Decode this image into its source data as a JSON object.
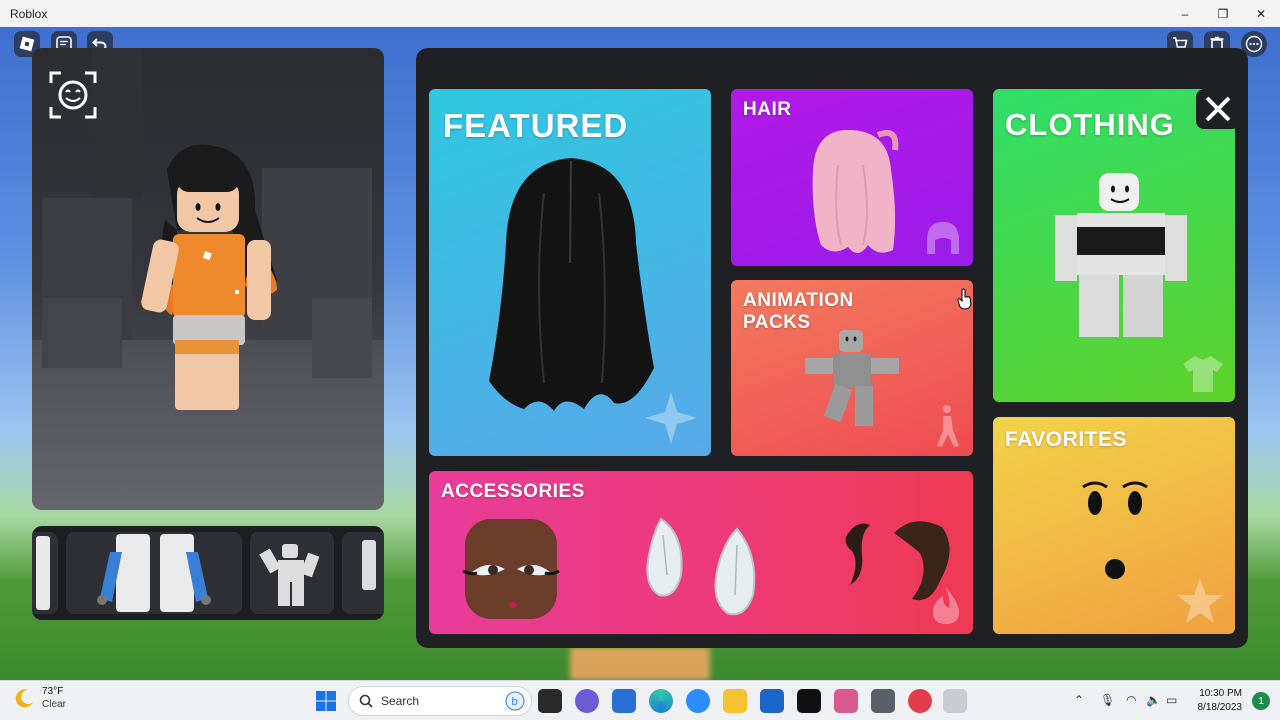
{
  "window": {
    "title": "Roblox",
    "min": "–",
    "max": "❐",
    "close": "✕"
  },
  "catalog": {
    "featured": "FEATURED",
    "hair": "HAIR",
    "animation_packs": [
      "ANIMATION",
      "PACKS"
    ],
    "clothing": "CLOTHING",
    "accessories": "ACCESSORIES",
    "favorites": "FAVORITES",
    "close_icon": "close-icon"
  },
  "colors": {
    "featured": [
      "#2fc7e0",
      "#58a8e8"
    ],
    "hair": [
      "#b219e6",
      "#9a1dea"
    ],
    "animation": [
      "#f37b5e",
      "#ee4b52"
    ],
    "clothing": [
      "#2fde6a",
      "#5fd12a"
    ],
    "accessories": [
      "#e83d9b",
      "#ee3a52"
    ],
    "favorites": [
      "#f2d34a",
      "#f0a040"
    ]
  },
  "taskbar": {
    "temperature": "73°F",
    "condition": "Clear",
    "search_placeholder": "Search",
    "time": "10:30 PM",
    "date": "8/18/2023",
    "notifications": "1"
  }
}
